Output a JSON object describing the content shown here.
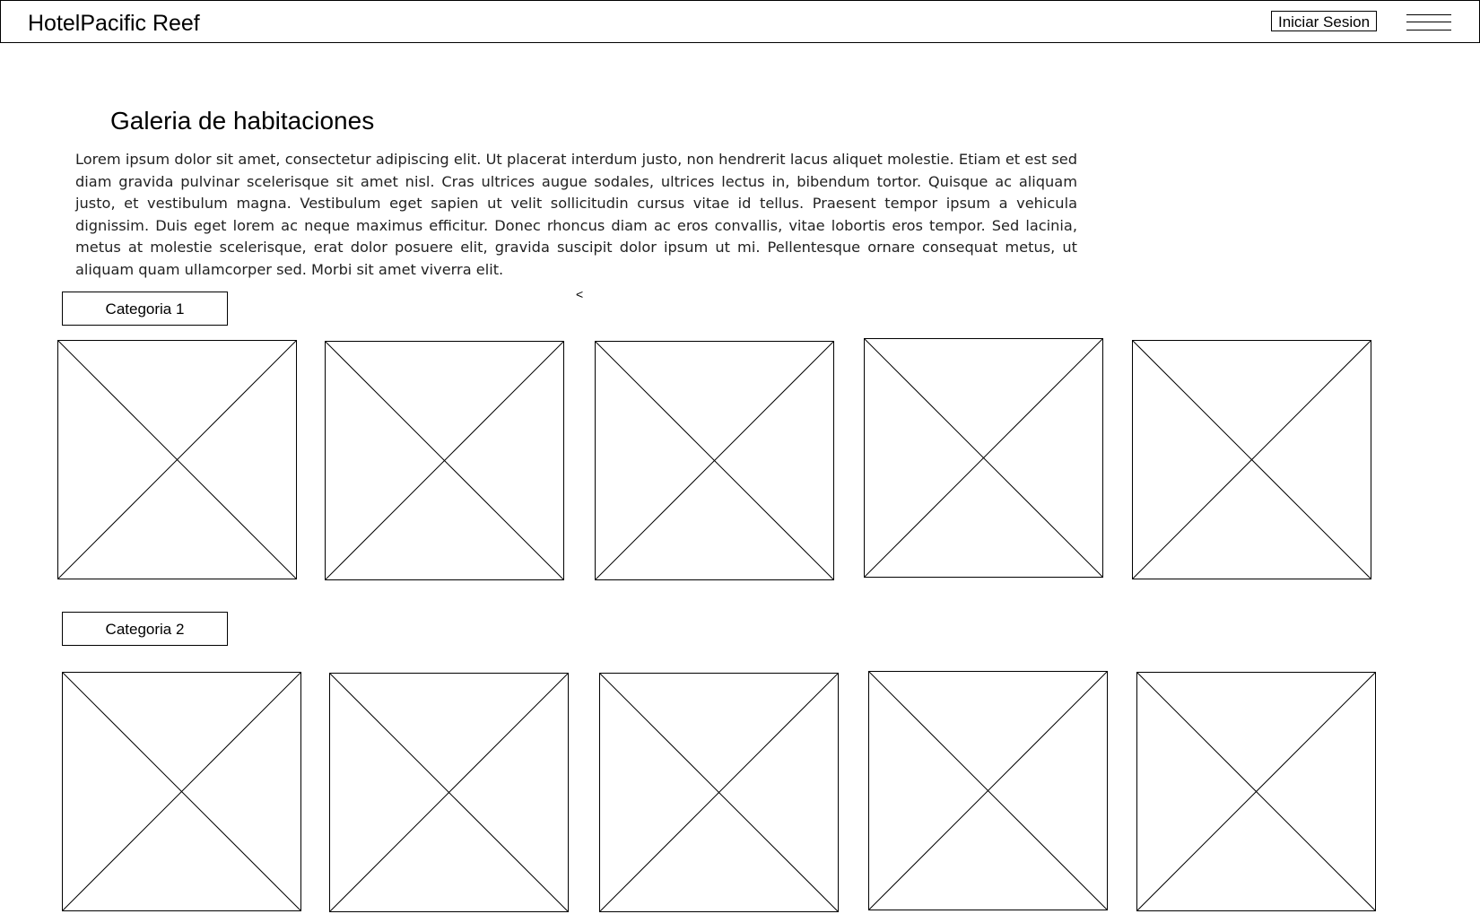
{
  "header": {
    "brand": "HotelPacific Reef",
    "login_label": "Iniciar Sesion",
    "menu_icon": "hamburger-menu-icon"
  },
  "main": {
    "title": "Galeria de habitaciones",
    "intro": "Lorem ipsum dolor sit amet, consectetur adipiscing elit. Ut placerat interdum justo, non hendrerit lacus aliquet molestie. Etiam et est sed diam gravida pulvinar scelerisque sit amet nisl. Cras ultrices augue sodales, ultrices lectus in, bibendum tortor. Quisque ac aliquam justo, et vestibulum magna. Vestibulum eget sapien ut velit sollicitudin cursus vitae id tellus. Praesent tempor ipsum a vehicula dignissim. Duis eget lorem ac neque maximus efficitur. Donec rhoncus diam ac eros convallis, vitae lobortis eros tempor. Sed lacinia, metus at molestie scelerisque, erat dolor posuere elit, gravida suscipit dolor ipsum ut mi. Pellentesque ornare consequat metus, ut aliquam quam ullamcorper sed. Morbi sit amet viverra elit.",
    "caret": "<"
  },
  "categories": [
    {
      "label": "Categoria 1",
      "image_count": 5
    },
    {
      "label": "Categoria 2",
      "image_count": 5
    }
  ]
}
